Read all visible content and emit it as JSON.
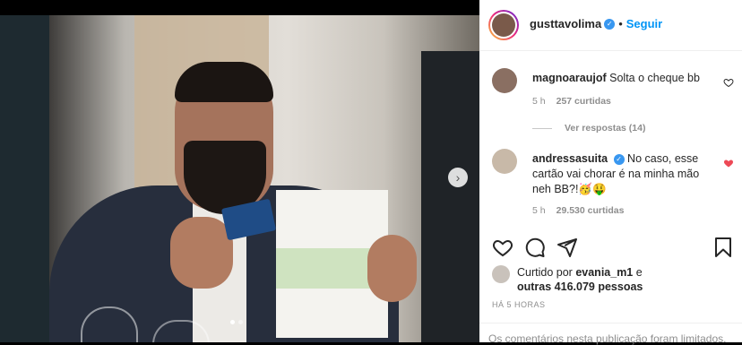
{
  "post": {
    "author": "gusttavolima",
    "follow_label": "Seguir",
    "separator": "•"
  },
  "comments": [
    {
      "user": "magnoaraujof",
      "text": "Solta o cheque bb",
      "time": "5 h",
      "likes": "257 curtidas",
      "liked": false
    },
    {
      "user": "andressasuita",
      "text": "No caso, esse cartão vai chorar é na minha mão neh BB?!🥳🤑",
      "time": "5 h",
      "likes": "29.530 curtidas",
      "liked": true,
      "verified": true
    }
  ],
  "view_replies": "Ver respostas (14)",
  "liked_by": {
    "prefix": "Curtido por",
    "user": "evania_m1",
    "connector": "e",
    "others": "outras 416.079 pessoas"
  },
  "timestamp": "HÁ 5 HORAS",
  "footer_text": "Os comentários nesta publicação foram limitados.",
  "carousel": {
    "total": 2,
    "current": 1
  },
  "colors": {
    "accent": "#0095f6",
    "heart_red": "#ed4956",
    "text": "#262626",
    "muted": "#8e8e8e"
  },
  "icons": [
    "heart-icon",
    "comment-icon",
    "share-icon",
    "save-icon",
    "chevron-right-icon",
    "verified-icon"
  ]
}
